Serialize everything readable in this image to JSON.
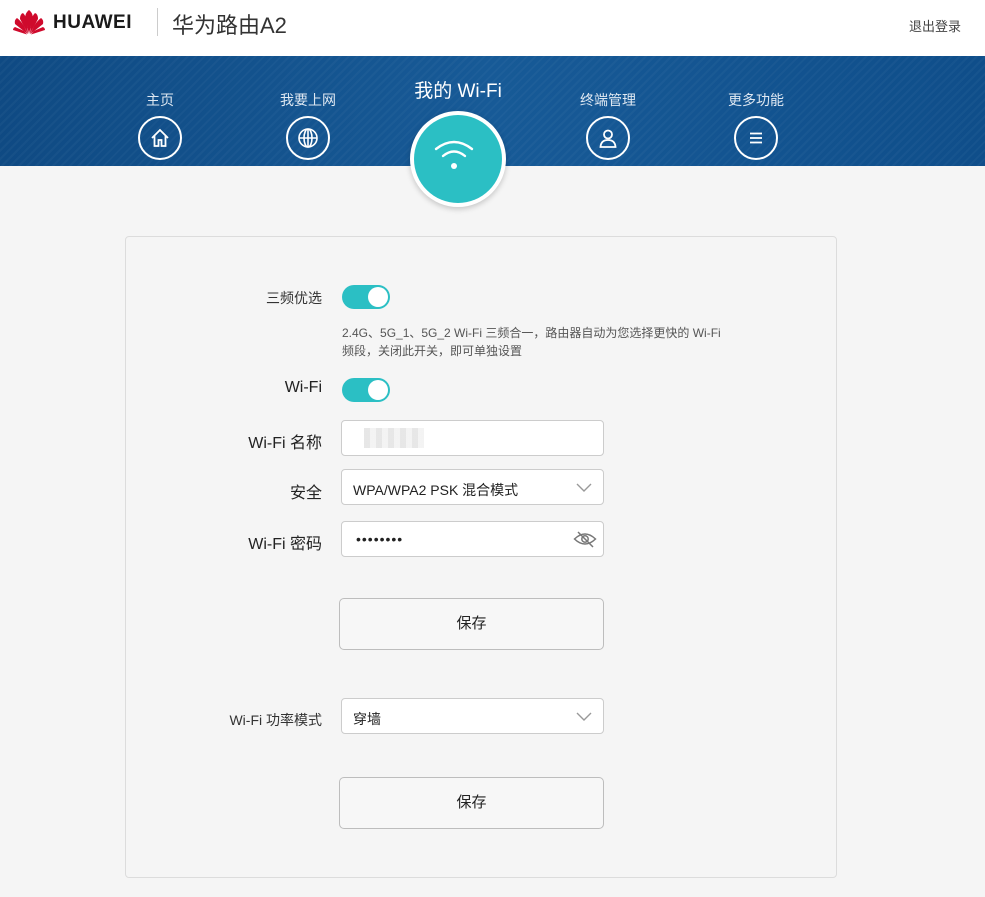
{
  "header": {
    "brand": "HUAWEI",
    "model": "华为路由A2",
    "logout_label": "退出登录",
    "brand_color": "#cf0a2c"
  },
  "nav": {
    "items": [
      {
        "label": "主页",
        "icon": "home-icon"
      },
      {
        "label": "我要上网",
        "icon": "globe-icon"
      },
      {
        "label": "我的 Wi-Fi",
        "icon": "wifi-icon",
        "active": true
      },
      {
        "label": "终端管理",
        "icon": "user-icon"
      },
      {
        "label": "更多功能",
        "icon": "menu-icon"
      }
    ],
    "active_color": "#2bbfc4"
  },
  "wifi": {
    "tri_band_label": "三频优选",
    "tri_band_on": true,
    "tri_band_hint": "2.4G、5G_1、5G_2 Wi-Fi 三频合一，路由器自动为您选择更快的 Wi-Fi 频段，关闭此开关，即可单独设置",
    "wifi_label": "Wi-Fi",
    "wifi_on": true,
    "name_label": "Wi-Fi 名称",
    "name_value": "",
    "security_label": "安全",
    "security_value": "WPA/WPA2 PSK 混合模式",
    "password_label": "Wi-Fi 密码",
    "password_value": "••••••••",
    "save_label": "保存",
    "power_label": "Wi-Fi 功率模式",
    "power_value": "穿墙",
    "save2_label": "保存"
  }
}
